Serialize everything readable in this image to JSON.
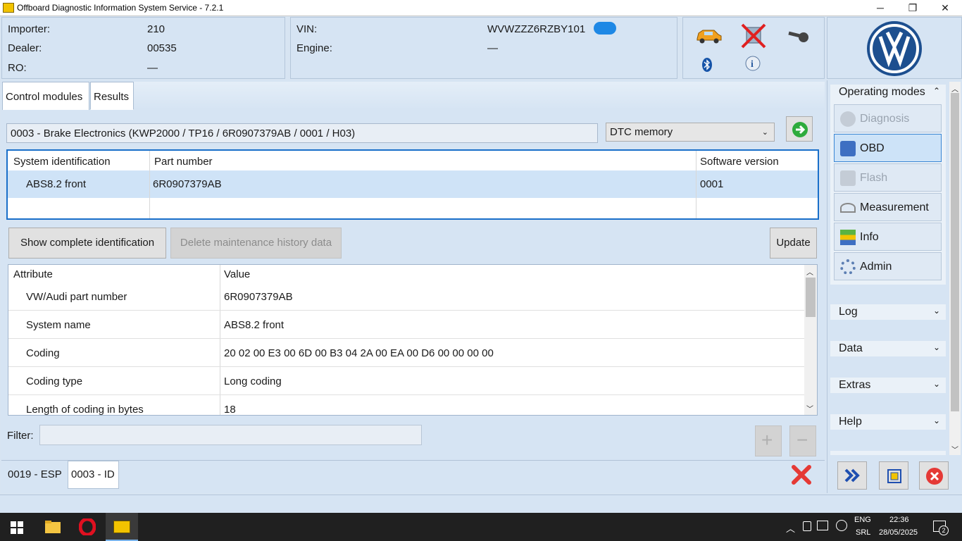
{
  "window": {
    "title": "Offboard Diagnostic Information System Service - 7.2.1",
    "min": "─",
    "max": "❐",
    "close": "✕"
  },
  "header": {
    "importer_label": "Importer:",
    "importer_value": "210",
    "dealer_label": "Dealer:",
    "dealer_value": "00535",
    "ro_label": "RO:",
    "ro_value": "—",
    "vin_label": "VIN:",
    "vin_value": "WVWZZZ6RZBY101",
    "engine_label": "Engine:",
    "engine_value": "—"
  },
  "tabs": {
    "control_modules": "Control modules",
    "results": "Results"
  },
  "module": {
    "title": "0003 - Brake Electronics  (KWP2000 / TP16 / 6R0907379AB / 0001 / H03)",
    "dropdown": "DTC memory"
  },
  "ident_table": {
    "headers": [
      "System identification",
      "Part number",
      "Software version"
    ],
    "rows": [
      [
        "ABS8.2 front",
        "6R0907379AB",
        "0001"
      ]
    ]
  },
  "buttons": {
    "show_complete": "Show complete identification",
    "delete_history": "Delete maintenance history data",
    "update": "Update"
  },
  "attr_table": {
    "headers": [
      "Attribute",
      "Value"
    ],
    "rows": [
      [
        "VW/Audi part number",
        "6R0907379AB"
      ],
      [
        "System name",
        "ABS8.2 front"
      ],
      [
        "Coding",
        "20 02 00 E3 00 6D 00 B3 04 2A 00 EA 00 D6 00 00 00 00"
      ],
      [
        "Coding type",
        "Long coding"
      ],
      [
        "Length of coding in bytes",
        "18"
      ]
    ]
  },
  "filter": {
    "label": "Filter:",
    "value": ""
  },
  "bottom_tabs": [
    "0019 - ESP",
    "0003 - ID"
  ],
  "sidebar": {
    "operating_modes": "Operating modes",
    "modes": [
      "Diagnosis",
      "OBD",
      "Flash",
      "Measurement",
      "Info",
      "Admin"
    ],
    "sections": [
      "Log",
      "Data",
      "Extras",
      "Help"
    ],
    "logo": "VW"
  },
  "taskbar": {
    "lang": "ENG",
    "layout": "SRL",
    "time": "22:36",
    "date": "28/05/2025",
    "notifications": "2"
  },
  "colors": {
    "panel": "#d6e4f3",
    "selected_row": "#cfe3f7",
    "accent_blue": "#1a6fc9",
    "close_red": "#e53935"
  }
}
